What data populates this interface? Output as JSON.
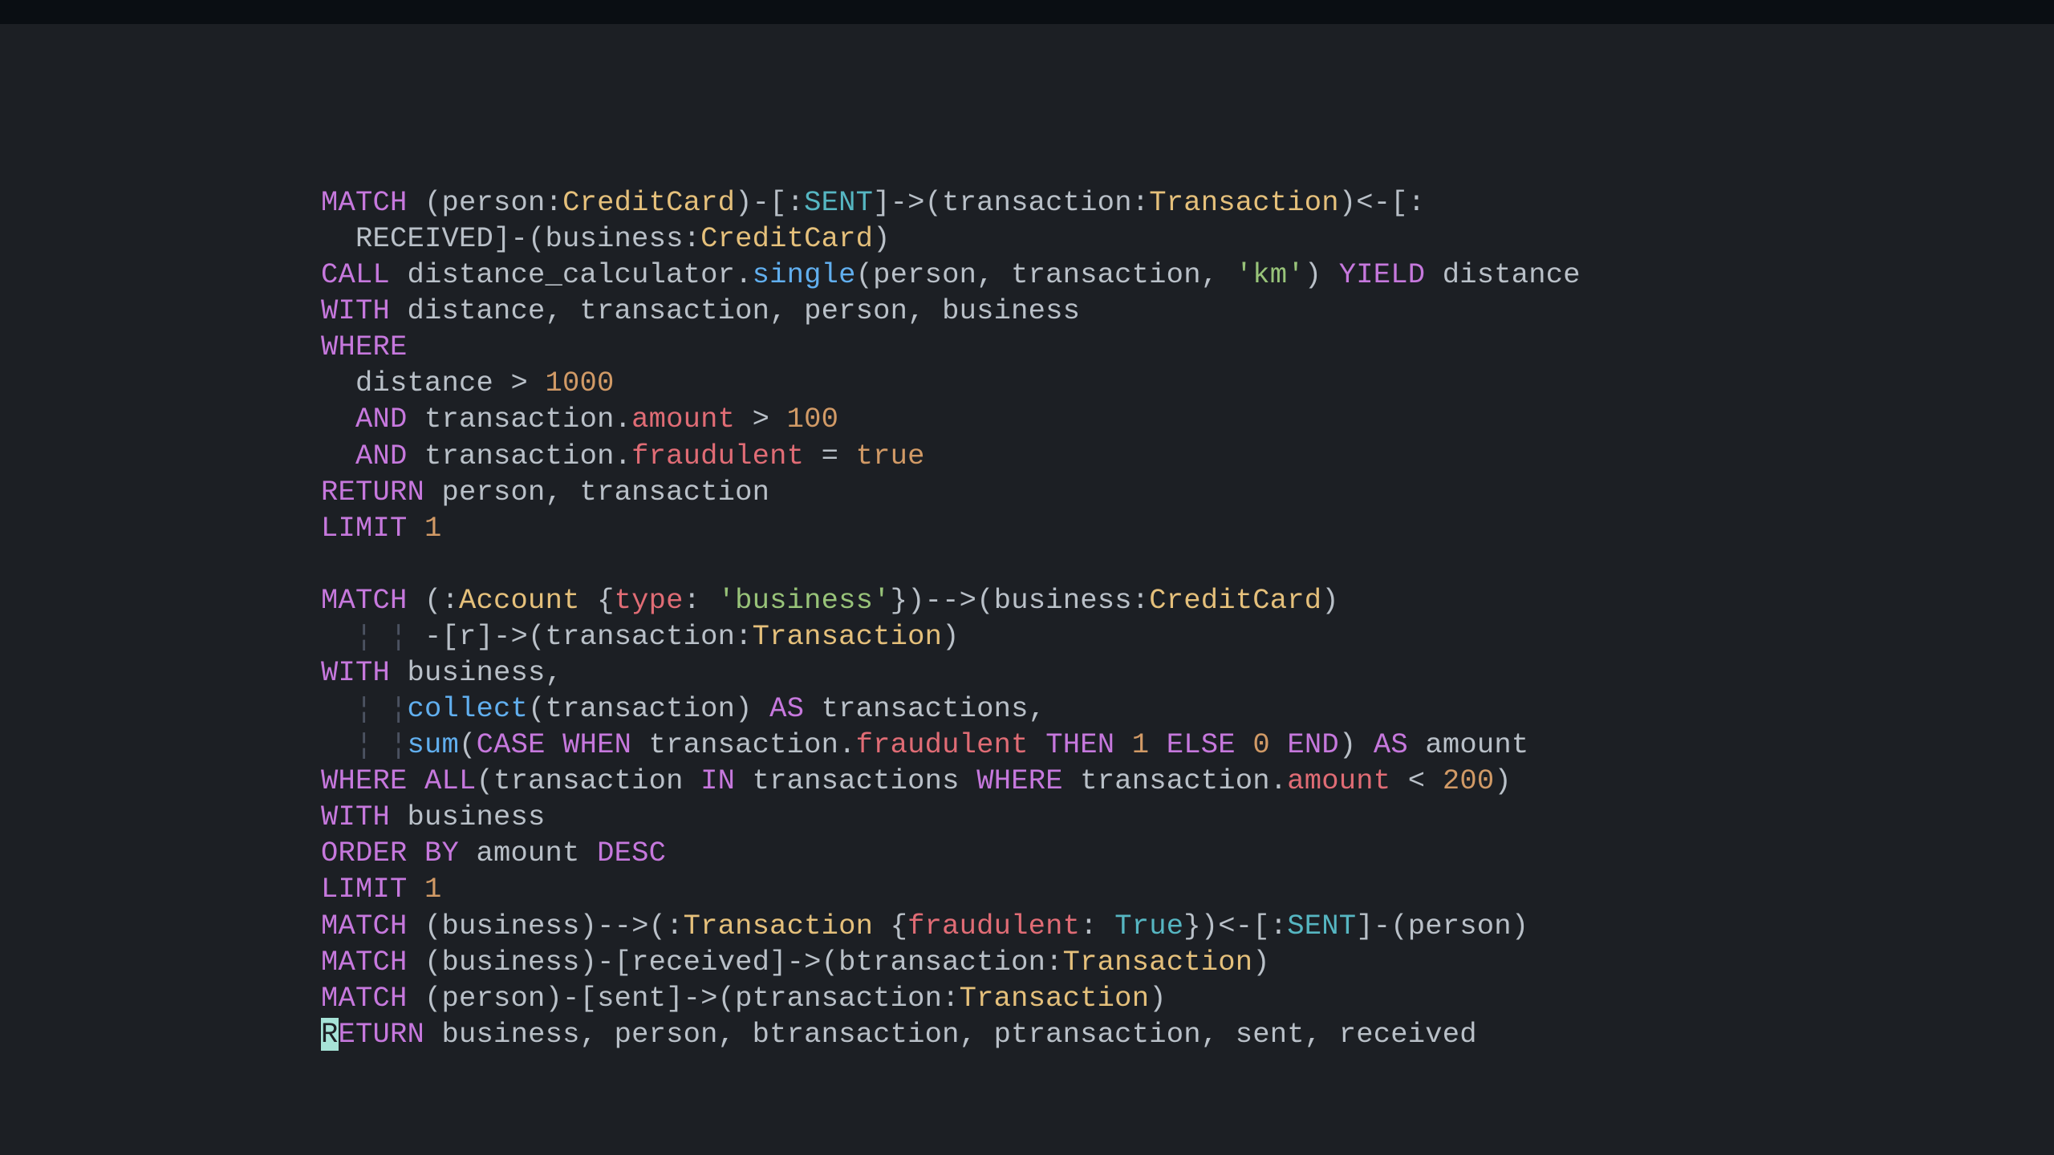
{
  "theme": {
    "bg_outer": "#0d1117",
    "bg_editor": "#1c1f24",
    "bg_titlebar": "#0a0e13",
    "keyword": "#c678dd",
    "identifier": "#b9c0c8",
    "function": "#61afef",
    "label": "#e5c07b",
    "number": "#d19a66",
    "string": "#98c379",
    "property": "#e06c75",
    "cyan": "#56b6c2",
    "indent_guide": "#4b5261",
    "cursor_bg": "#a6e3d7",
    "cursor_line_bg": "#2c313a"
  },
  "editor": {
    "language": "cypher",
    "font": "monospace",
    "cursor": {
      "line": 24,
      "col": 0
    }
  },
  "code_lines": [
    [
      {
        "t": "MATCH",
        "c": "kw"
      },
      {
        "t": " (person:",
        "c": "ident"
      },
      {
        "t": "CreditCard",
        "c": "label"
      },
      {
        "t": ")-[:",
        "c": "ident"
      },
      {
        "t": "SENT",
        "c": "cyan"
      },
      {
        "t": "]->(transaction:",
        "c": "ident"
      },
      {
        "t": "Transaction",
        "c": "label"
      },
      {
        "t": ")<-[:",
        "c": "ident"
      }
    ],
    [
      {
        "t": "  RECEIVED]-(business:",
        "c": "ident"
      },
      {
        "t": "CreditCard",
        "c": "label"
      },
      {
        "t": ")",
        "c": "ident"
      }
    ],
    [
      {
        "t": "CALL",
        "c": "kw"
      },
      {
        "t": " distance_calculator.",
        "c": "ident"
      },
      {
        "t": "single",
        "c": "func"
      },
      {
        "t": "(person, transaction, ",
        "c": "ident"
      },
      {
        "t": "'km'",
        "c": "str"
      },
      {
        "t": ") ",
        "c": "ident"
      },
      {
        "t": "YIELD",
        "c": "kw"
      },
      {
        "t": " distance",
        "c": "ident"
      }
    ],
    [
      {
        "t": "WITH",
        "c": "kw"
      },
      {
        "t": " distance, transaction, person, business",
        "c": "ident"
      }
    ],
    [
      {
        "t": "WHERE",
        "c": "kw"
      }
    ],
    [
      {
        "t": "  distance > ",
        "c": "ident"
      },
      {
        "t": "1000",
        "c": "num"
      }
    ],
    [
      {
        "t": "  ",
        "c": "ident"
      },
      {
        "t": "AND",
        "c": "kw"
      },
      {
        "t": " transaction.",
        "c": "ident"
      },
      {
        "t": "amount",
        "c": "prop"
      },
      {
        "t": " > ",
        "c": "ident"
      },
      {
        "t": "100",
        "c": "num"
      }
    ],
    [
      {
        "t": "  ",
        "c": "ident"
      },
      {
        "t": "AND",
        "c": "kw"
      },
      {
        "t": " transaction.",
        "c": "ident"
      },
      {
        "t": "fraudulent",
        "c": "prop"
      },
      {
        "t": " = ",
        "c": "ident"
      },
      {
        "t": "true",
        "c": "num"
      }
    ],
    [
      {
        "t": "RETURN",
        "c": "kw"
      },
      {
        "t": " person, transaction",
        "c": "ident"
      }
    ],
    [
      {
        "t": "LIMIT",
        "c": "kw"
      },
      {
        "t": " ",
        "c": "ident"
      },
      {
        "t": "1",
        "c": "num"
      }
    ],
    [
      {
        "t": " ",
        "c": "ident"
      }
    ],
    [
      {
        "t": "MATCH",
        "c": "kw"
      },
      {
        "t": " (:",
        "c": "ident"
      },
      {
        "t": "Account",
        "c": "label"
      },
      {
        "t": " {",
        "c": "ident"
      },
      {
        "t": "type",
        "c": "prop"
      },
      {
        "t": ": ",
        "c": "ident"
      },
      {
        "t": "'business'",
        "c": "str"
      },
      {
        "t": "})-->(business:",
        "c": "ident"
      },
      {
        "t": "CreditCard",
        "c": "label"
      },
      {
        "t": ")",
        "c": "ident"
      }
    ],
    [
      {
        "t": "  ",
        "c": "ident"
      },
      {
        "t": "¦ ¦ ",
        "c": "dim"
      },
      {
        "t": "-[r]->(transaction:",
        "c": "ident"
      },
      {
        "t": "Transaction",
        "c": "label"
      },
      {
        "t": ")",
        "c": "ident"
      }
    ],
    [
      {
        "t": "WITH",
        "c": "kw"
      },
      {
        "t": " business,",
        "c": "ident"
      }
    ],
    [
      {
        "t": "  ",
        "c": "ident"
      },
      {
        "t": "¦ ¦",
        "c": "dim"
      },
      {
        "t": "collect",
        "c": "func"
      },
      {
        "t": "(transaction) ",
        "c": "ident"
      },
      {
        "t": "AS",
        "c": "kw"
      },
      {
        "t": " transactions,",
        "c": "ident"
      }
    ],
    [
      {
        "t": "  ",
        "c": "ident"
      },
      {
        "t": "¦ ¦",
        "c": "dim"
      },
      {
        "t": "sum",
        "c": "func"
      },
      {
        "t": "(",
        "c": "ident"
      },
      {
        "t": "CASE",
        "c": "kw"
      },
      {
        "t": " ",
        "c": "ident"
      },
      {
        "t": "WHEN",
        "c": "kw"
      },
      {
        "t": " transaction.",
        "c": "ident"
      },
      {
        "t": "fraudulent",
        "c": "prop"
      },
      {
        "t": " ",
        "c": "ident"
      },
      {
        "t": "THEN",
        "c": "kw"
      },
      {
        "t": " ",
        "c": "ident"
      },
      {
        "t": "1",
        "c": "num"
      },
      {
        "t": " ",
        "c": "ident"
      },
      {
        "t": "ELSE",
        "c": "kw"
      },
      {
        "t": " ",
        "c": "ident"
      },
      {
        "t": "0",
        "c": "num"
      },
      {
        "t": " ",
        "c": "ident"
      },
      {
        "t": "END",
        "c": "kw"
      },
      {
        "t": ") ",
        "c": "ident"
      },
      {
        "t": "AS",
        "c": "kw"
      },
      {
        "t": " amount",
        "c": "ident"
      }
    ],
    [
      {
        "t": "WHERE",
        "c": "kw"
      },
      {
        "t": " ",
        "c": "ident"
      },
      {
        "t": "ALL",
        "c": "kw"
      },
      {
        "t": "(transaction ",
        "c": "ident"
      },
      {
        "t": "IN",
        "c": "kw"
      },
      {
        "t": " transactions ",
        "c": "ident"
      },
      {
        "t": "WHERE",
        "c": "kw"
      },
      {
        "t": " transaction.",
        "c": "ident"
      },
      {
        "t": "amount",
        "c": "prop"
      },
      {
        "t": " < ",
        "c": "ident"
      },
      {
        "t": "200",
        "c": "num"
      },
      {
        "t": ")",
        "c": "ident"
      }
    ],
    [
      {
        "t": "WITH",
        "c": "kw"
      },
      {
        "t": " business",
        "c": "ident"
      }
    ],
    [
      {
        "t": "ORDER BY",
        "c": "kw"
      },
      {
        "t": " amount ",
        "c": "ident"
      },
      {
        "t": "DESC",
        "c": "kw"
      }
    ],
    [
      {
        "t": "LIMIT",
        "c": "kw"
      },
      {
        "t": " ",
        "c": "ident"
      },
      {
        "t": "1",
        "c": "num"
      }
    ],
    [
      {
        "t": "MATCH",
        "c": "kw"
      },
      {
        "t": " (business)-->(:",
        "c": "ident"
      },
      {
        "t": "Transaction",
        "c": "label"
      },
      {
        "t": " {",
        "c": "ident"
      },
      {
        "t": "fraudulent",
        "c": "prop"
      },
      {
        "t": ": ",
        "c": "ident"
      },
      {
        "t": "True",
        "c": "cyan"
      },
      {
        "t": "})<-[:",
        "c": "ident"
      },
      {
        "t": "SENT",
        "c": "cyan"
      },
      {
        "t": "]-(person)",
        "c": "ident"
      }
    ],
    [
      {
        "t": "MATCH",
        "c": "kw"
      },
      {
        "t": " (business)-[received]->(btransaction:",
        "c": "ident"
      },
      {
        "t": "Transaction",
        "c": "label"
      },
      {
        "t": ")",
        "c": "ident"
      }
    ],
    [
      {
        "t": "MATCH",
        "c": "kw"
      },
      {
        "t": " (person)-[sent]->(ptransaction:",
        "c": "ident"
      },
      {
        "t": "Transaction",
        "c": "label"
      },
      {
        "t": ")",
        "c": "ident"
      }
    ],
    [
      {
        "t": "R",
        "c": "cursor"
      },
      {
        "t": "ETURN",
        "c": "kw"
      },
      {
        "t": " business, person, btransaction, ptransaction, sent, received",
        "c": "ident"
      }
    ]
  ]
}
